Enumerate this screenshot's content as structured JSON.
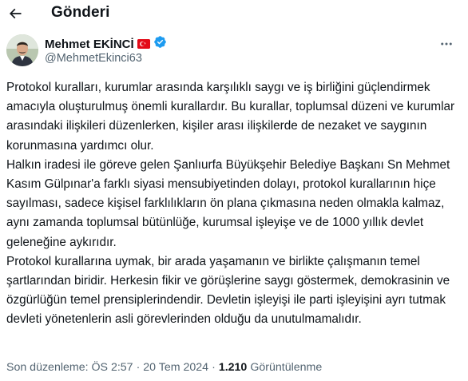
{
  "header": {
    "title": "Gönderi",
    "back_icon": "arrow-left-icon"
  },
  "author": {
    "name": "Mehmet EKİNCİ",
    "handle": "@MehmetEkinci63",
    "flag_icon": "turkey-flag-icon",
    "verified_icon": "verified-badge-icon",
    "more_icon": "more-horizontal-icon"
  },
  "post": {
    "text": "Protokol kuralları, kurumlar arasında karşılıklı saygı ve iş birliğini güçlendirmek amacıyla oluşturulmuş önemli kurallardır. Bu kurallar, toplumsal düzeni ve kurumlar arasındaki ilişkileri düzenlerken, kişiler arası ilişkilerde de nezaket ve saygının korunmasına yardımcı olur.\nHalkın iradesi ile göreve gelen Şanlıurfa Büyükşehir Belediye Başkanı Sn Mehmet Kasım Gülpınar'a farklı siyasi mensubiyetinden dolayı, protokol kurallarının hiçe sayılması, sadece kişisel farklılıkların ön plana çıkmasına neden olmakla kalmaz, aynı zamanda toplumsal bütünlüğe, kurumsal işleyişe ve de 1000 yıllık devlet geleneğine aykırıdır.\nProtokol kurallarına uymak, bir arada yaşamanın ve birlikte çalışmanın temel şartlarından biridir. Herkesin fikir ve görüşlerine saygı göstermek, demokrasinin ve özgürlüğün temel prensiplerindendir. Devletin işleyişi ile parti işleyişini ayrı tutmak devleti yönetenlerin asli görevlerinden olduğu da unutulmamalıdır."
  },
  "meta": {
    "edited_label": "Son düzenleme:",
    "time": "ÖS 2:57",
    "date": "20 Tem 2024",
    "separator": "·",
    "views": "1.210",
    "views_label": "Görüntülenme"
  },
  "colors": {
    "verified": "#1d9bf0",
    "muted": "#536471",
    "flag": "#e30a17"
  }
}
